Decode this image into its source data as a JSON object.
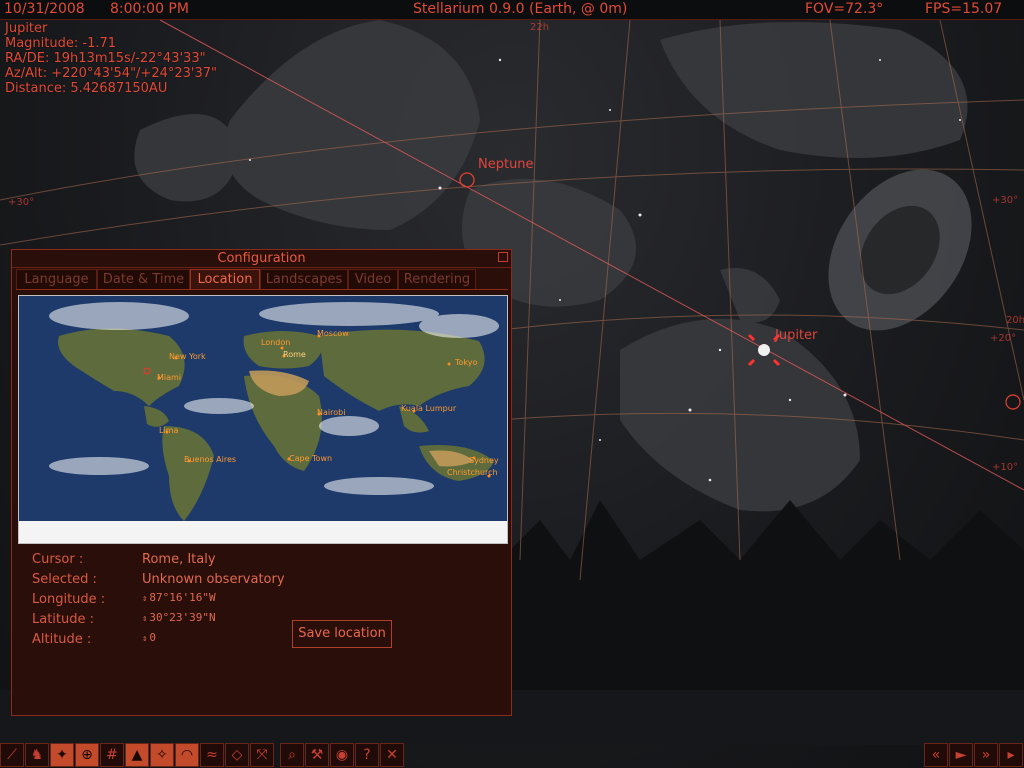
{
  "topbar": {
    "date": "10/31/2008",
    "time": "8:00:00 PM",
    "app_title": "Stellarium 0.9.0 (Earth,  @ 0m)",
    "fov": "FOV=72.3°",
    "fps": "FPS=15.07"
  },
  "object_info": {
    "name": "Jupiter",
    "magnitude": "Magnitude: -1.71",
    "radec": "RA/DE: 19h13m15s/-22°43'33\"",
    "azalt": "Az/Alt: +220°43'54\"/+24°23'37\"",
    "distance": "Distance: 5.42687150AU"
  },
  "sky_labels": {
    "neptune": "Neptune",
    "jupiter": "Jupiter",
    "grid_30_left": "+30°",
    "grid_30_right": "+30°",
    "grid_20_right": "+20°",
    "grid_10_right": "+10°",
    "grid_20h": "20h",
    "grid_22h": "22h"
  },
  "config": {
    "title": "Configuration",
    "tabs": [
      "Language",
      "Date & Time",
      "Location",
      "Landscapes",
      "Video",
      "Rendering"
    ],
    "active_tab": "Location",
    "map_cities": {
      "new_york": "New York",
      "miami": "Miami",
      "london": "London",
      "rome": "Rome",
      "moscow": "Moscow",
      "tokyo": "Tokyo",
      "nairobi": "Nairobi",
      "kuala_lumpur": "Kuala Lumpur",
      "lima": "Lima",
      "buenos_aires": "Buenos Aires",
      "cape_town": "Cape Town",
      "sydney": "Sydney",
      "christchurch": "Christchurch"
    },
    "location": {
      "cursor_label": "Cursor :",
      "cursor_value": "Rome, Italy",
      "selected_label": "Selected :",
      "selected_value": "Unknown observatory",
      "longitude_label": "Longitude :",
      "longitude_value": "87°16'16\"W",
      "latitude_label": "Latitude :",
      "latitude_value": "30°23'39\"N",
      "altitude_label": "Altitude :",
      "altitude_value": "0",
      "save_button": "Save location"
    }
  },
  "toolbar": {
    "left_icons": [
      "constellation-lines-icon",
      "constellation-art-icon",
      "constellation-names-icon",
      "equatorial-grid-icon",
      "azimuthal-grid-icon",
      "ground-icon",
      "cardinal-points-icon",
      "atmosphere-icon",
      "nebulae-icon",
      "planet-hint-icon",
      "equatorial-mount-icon",
      "search-icon",
      "config-icon",
      "night-mode-icon",
      "help-icon",
      "quit-icon"
    ],
    "right_icons": [
      "rewind-icon",
      "play-icon",
      "fast-forward-icon",
      "realtime-icon"
    ],
    "help_glyph": "?",
    "quit_glyph": "✕"
  },
  "colors": {
    "accent": "#e04030",
    "panel_bg": "#2a0e09",
    "sky_bg": "#1a1b1e"
  }
}
